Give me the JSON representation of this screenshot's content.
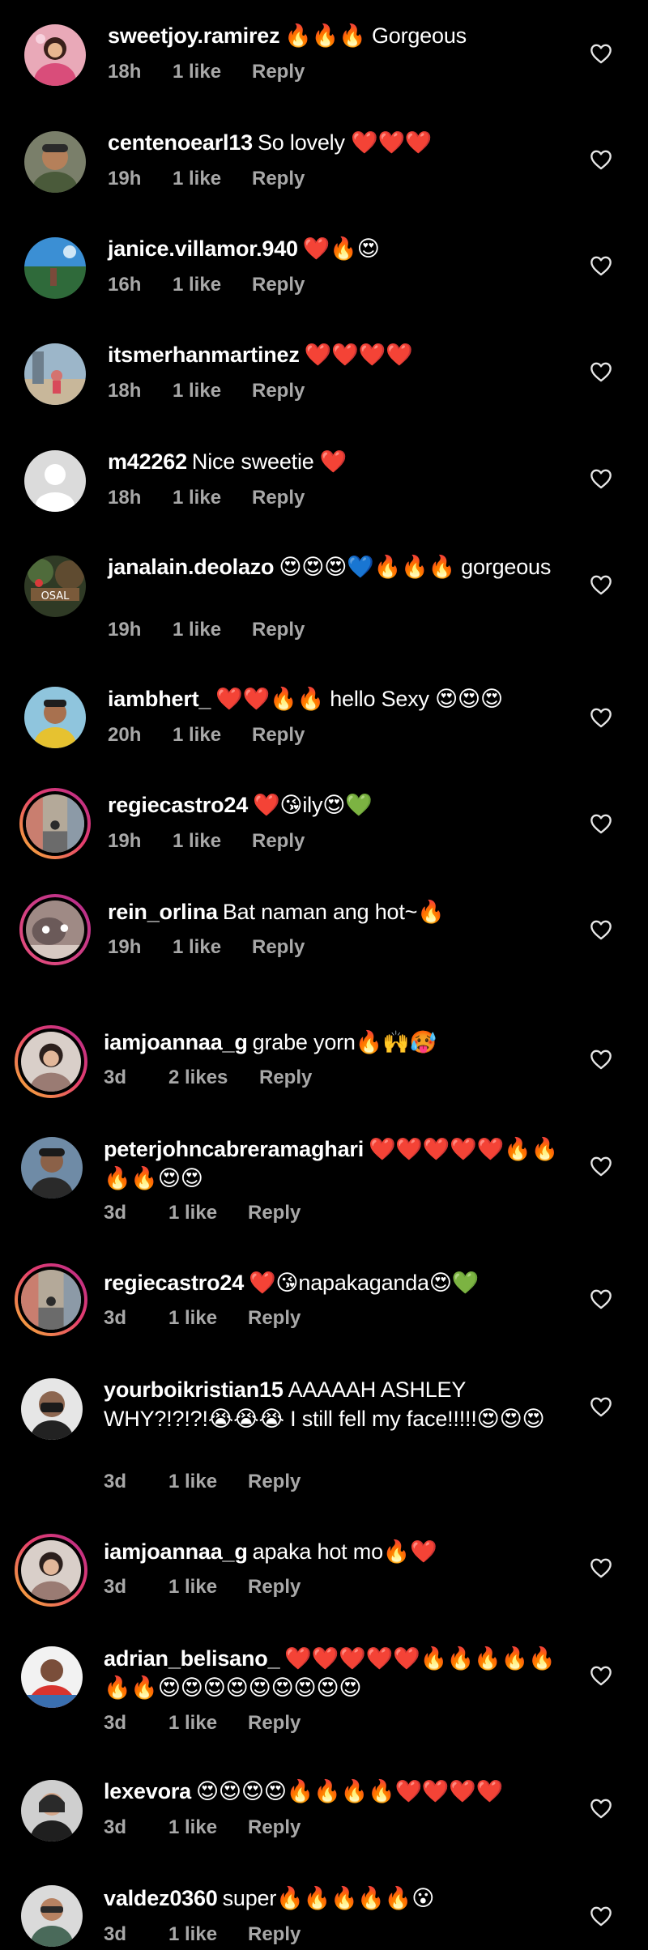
{
  "ui": {
    "reply_label": "Reply"
  },
  "comments": [
    {
      "username": "sweetjoy.ramirez",
      "text": "🔥🔥🔥 Gorgeous",
      "time": "18h",
      "likes": "1 like"
    },
    {
      "username": "centenoearl13",
      "text": "So lovely ❤️❤️❤️",
      "time": "19h",
      "likes": "1 like"
    },
    {
      "username": "janice.villamor.940",
      "text": "❤️🔥😍",
      "time": "16h",
      "likes": "1 like"
    },
    {
      "username": "itsmerhanmartinez",
      "text": "❤️❤️❤️❤️",
      "time": "18h",
      "likes": "1 like"
    },
    {
      "username": "m42262",
      "text": "Nice sweetie ❤️",
      "time": "18h",
      "likes": "1 like"
    },
    {
      "username": "janalain.deolazo",
      "text": "😍😍😍💙🔥🔥🔥 gorgeous",
      "time": "19h",
      "likes": "1 like"
    },
    {
      "username": "iambhert_",
      "text": "❤️❤️🔥🔥 hello Sexy 😍😍😍",
      "time": "20h",
      "likes": "1 like"
    },
    {
      "username": "regiecastro24",
      "text": "❤️😘ily😍💚",
      "time": "19h",
      "likes": "1 like"
    },
    {
      "username": "rein_orlina",
      "text": "Bat naman ang hot~🔥",
      "time": "19h",
      "likes": "1 like"
    },
    {
      "username": "iamjoannaa_g",
      "text": "grabe yorn🔥🙌🥵",
      "time": "3d",
      "likes": "2 likes"
    },
    {
      "username": "peterjohncabreramaghari",
      "text": "❤️❤️❤️❤️❤️🔥🔥🔥🔥😍😍",
      "time": "3d",
      "likes": "1 like"
    },
    {
      "username": "regiecastro24",
      "text": "❤️😘napakaganda😍💚",
      "time": "3d",
      "likes": "1 like"
    },
    {
      "username": "yourboikristian15",
      "text": "AAAAAH ASHLEY WHY?!?!?!😭😭😭 I still fell my face!!!!!😍😍😍",
      "time": "3d",
      "likes": "1 like"
    },
    {
      "username": "iamjoannaa_g",
      "text": "apaka hot mo🔥❤️",
      "time": "3d",
      "likes": "1 like"
    },
    {
      "username": "adrian_belisano_",
      "text": "❤️❤️❤️❤️❤️🔥🔥🔥🔥🔥🔥🔥😍😍😍😍😍😍😍😍😍",
      "time": "3d",
      "likes": "1 like"
    },
    {
      "username": "lexevora",
      "text": "😍😍😍😍🔥🔥🔥🔥❤️❤️❤️❤️",
      "time": "3d",
      "likes": "1 like"
    },
    {
      "username": "valdez0360",
      "text": "super🔥🔥🔥🔥🔥😮",
      "time": "3d",
      "likes": "1 like"
    }
  ]
}
